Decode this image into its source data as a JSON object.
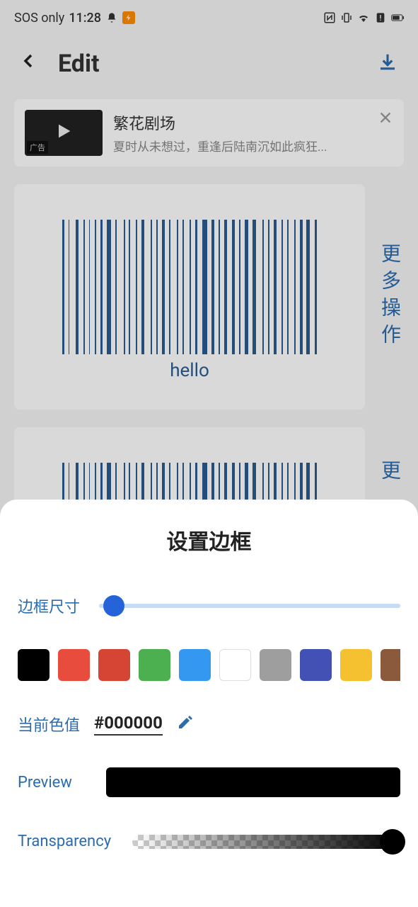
{
  "status_bar": {
    "network": "SOS only",
    "time": "11:28"
  },
  "header": {
    "title": "Edit"
  },
  "ad": {
    "title": "繁花剧场",
    "subtitle": "夏时从未想过，重逢后陆南沉如此疯狂...",
    "label": "广告"
  },
  "barcode": {
    "text": "hello"
  },
  "side_actions": {
    "more": "更多操作",
    "more2": "更"
  },
  "sheet": {
    "title": "设置边框",
    "border_size_label": "边框尺寸",
    "border_size_value": 3,
    "colors": [
      "#000000",
      "#e84c3d",
      "#d64534",
      "#4caf50",
      "#3498f1",
      "#ffffff",
      "#9e9e9e",
      "#4351b5",
      "#f5c131",
      "#8b5a3c"
    ],
    "color_value_label": "当前色值",
    "color_value": "#000000",
    "preview_label": "Preview",
    "preview_color": "#000000",
    "transparency_label": "Transparency",
    "transparency_value": 100
  }
}
